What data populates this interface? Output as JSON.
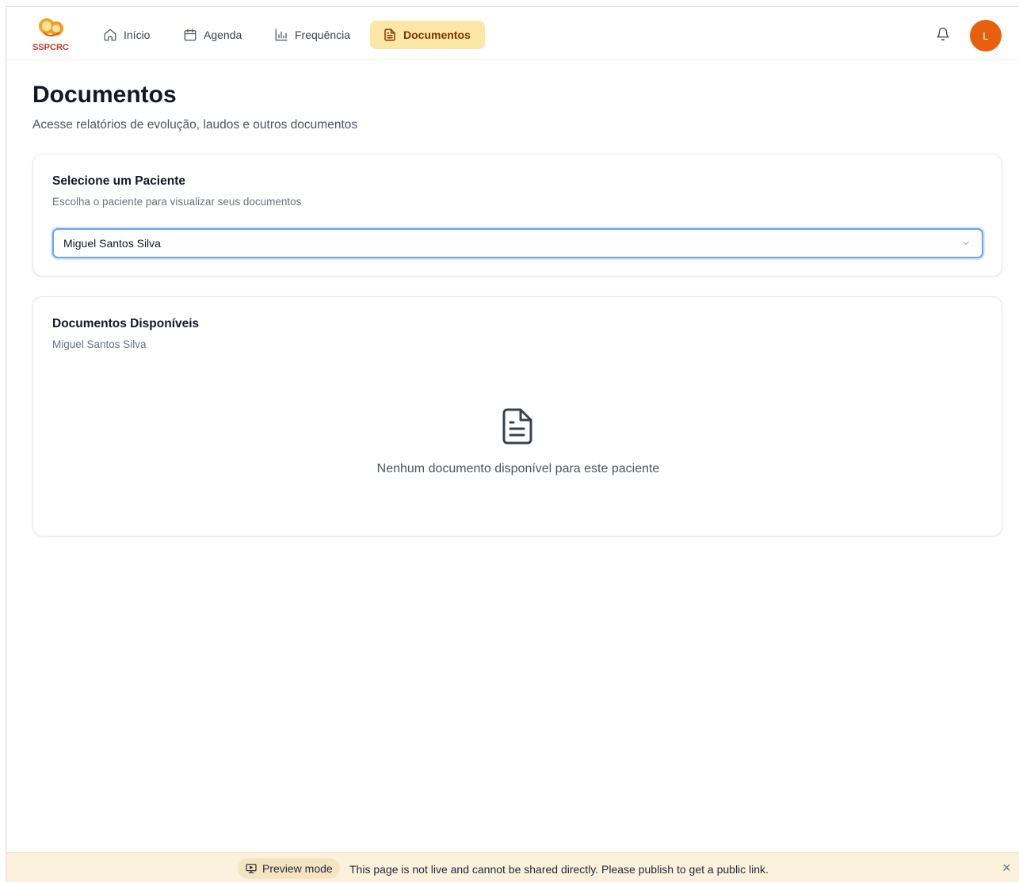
{
  "app": {
    "logo_text": "SSPCRC",
    "accent_color": "#e8600c",
    "active_tab_bg": "#fde7a6"
  },
  "nav": {
    "items": [
      {
        "label": "Início",
        "icon": "home-icon",
        "active": false
      },
      {
        "label": "Agenda",
        "icon": "calendar-icon",
        "active": false
      },
      {
        "label": "Frequência",
        "icon": "bar-chart-icon",
        "active": false
      },
      {
        "label": "Documentos",
        "icon": "file-text-icon",
        "active": true
      }
    ],
    "avatar_initial": "L"
  },
  "page": {
    "title": "Documentos",
    "subtitle": "Acesse relatórios de evolução, laudos e outros documentos"
  },
  "patient_card": {
    "title": "Selecione um Paciente",
    "description": "Escolha o paciente para visualizar seus documentos",
    "selected_patient": "Miguel Santos Silva"
  },
  "documents_card": {
    "title": "Documentos Disponíveis",
    "patient_name": "Miguel Santos Silva",
    "empty_message": "Nenhum documento disponível para este paciente"
  },
  "preview_bar": {
    "label": "Preview mode",
    "message": "This page is not live and cannot be shared directly. Please publish to get a public link.",
    "close": "×"
  }
}
